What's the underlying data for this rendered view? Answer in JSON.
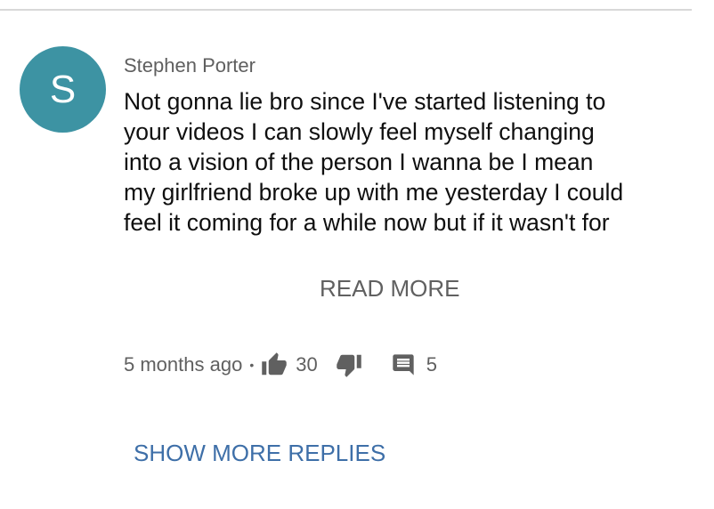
{
  "comment": {
    "avatar_letter": "S",
    "avatar_color": "#3d93a3",
    "author": "Stephen Porter",
    "text_lines": [
      "Not gonna lie bro since I've started listening to",
      "your videos I can slowly feel myself changing",
      "into a vision of the person I wanna be I mean",
      "my girlfriend broke up with me yesterday I could",
      "feel it coming for a while now but if it wasn't for"
    ],
    "read_more_label": "READ MORE",
    "timestamp": "5 months ago",
    "separator": "•",
    "like_icon": "thumbs-up-icon",
    "like_count": "30",
    "dislike_icon": "thumbs-down-icon",
    "reply_icon": "comment-icon",
    "reply_count": "5"
  },
  "show_more_replies_label": "SHOW MORE REPLIES",
  "colors": {
    "link_blue": "#3e6fa8",
    "secondary_text": "#606060"
  }
}
